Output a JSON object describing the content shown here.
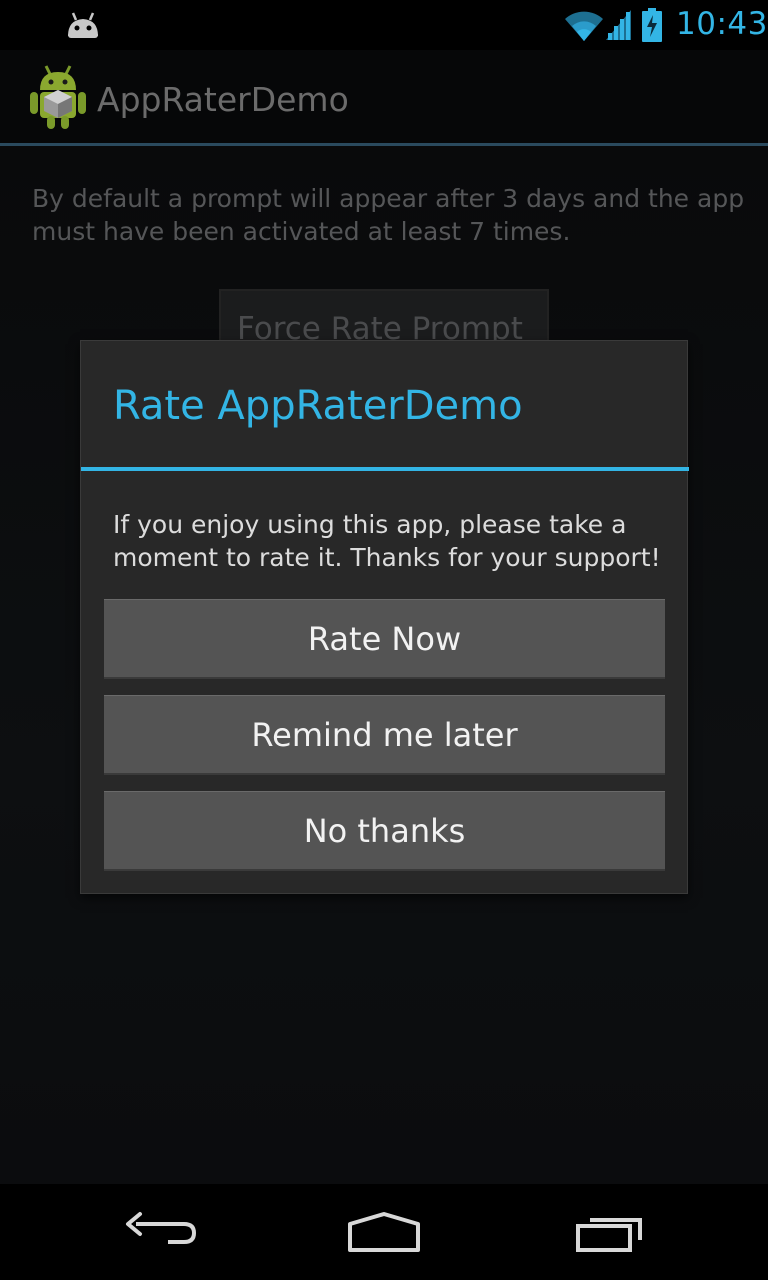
{
  "status_bar": {
    "time": "10:43",
    "icons": [
      "android-notification-icon",
      "wifi-icon",
      "signal-icon",
      "battery-charging-icon"
    ],
    "accent_color": "#33b5e5"
  },
  "action_bar": {
    "app_icon": "android-robot-icon",
    "title": "AppRaterDemo"
  },
  "content": {
    "description": "By default a prompt will appear after 3 days and the app must have been activated at least 7 times.",
    "force_button_label": "Force Rate Prompt"
  },
  "dialog": {
    "title": "Rate AppRaterDemo",
    "message": "If you enjoy using this app, please take a moment to rate it. Thanks for your support!",
    "buttons": {
      "rate_now": "Rate Now",
      "remind_later": "Remind me later",
      "no_thanks": "No thanks"
    },
    "title_color": "#33b5e5"
  },
  "nav_bar": {
    "buttons": [
      "back-icon",
      "home-icon",
      "recents-icon"
    ]
  }
}
